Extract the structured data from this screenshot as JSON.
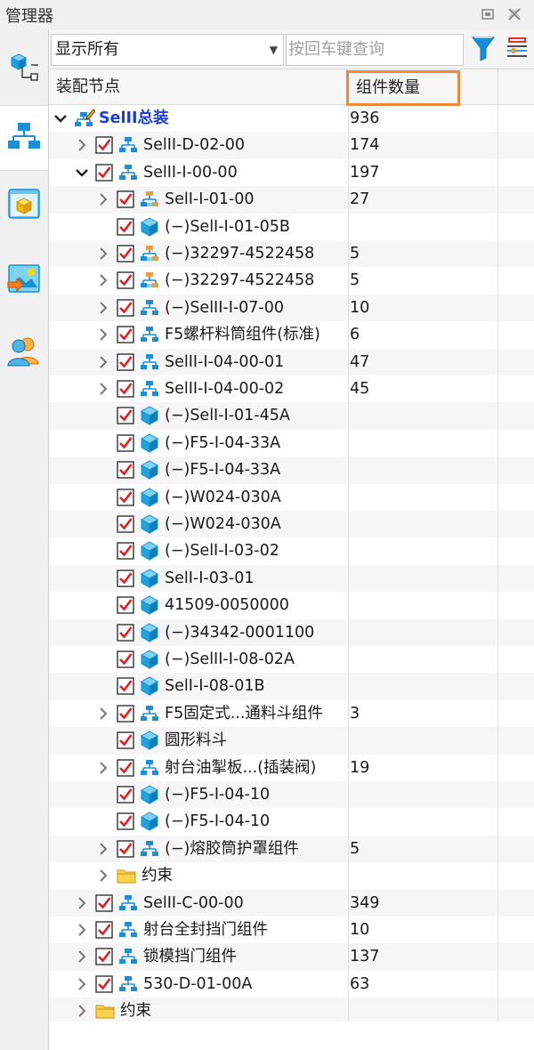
{
  "window": {
    "title": "管理器"
  },
  "toolbar": {
    "filter_value": "显示所有",
    "search_placeholder": "按回车键查询"
  },
  "columns": {
    "node": "装配节点",
    "count": "组件数量"
  },
  "left_tabs": [
    {
      "name": "tab-assembly-constraint",
      "icon": "part-tree-icon"
    },
    {
      "name": "tab-assembly-tree",
      "icon": "hierarchy-icon",
      "active": true
    },
    {
      "name": "tab-part-view",
      "icon": "cube-window-icon"
    },
    {
      "name": "tab-image-view",
      "icon": "picture-arrow-icon"
    },
    {
      "name": "tab-users",
      "icon": "users-icon"
    }
  ],
  "rows": [
    {
      "level": 0,
      "expander": "down",
      "check": false,
      "icon": "assembly-edit",
      "label": "SelII总装",
      "count": "936",
      "root": true
    },
    {
      "level": 1,
      "expander": "right",
      "check": true,
      "icon": "assembly",
      "label": "SelII-D-02-00",
      "count": "174"
    },
    {
      "level": 1,
      "expander": "down",
      "check": true,
      "icon": "assembly",
      "label": "SelII-I-00-00",
      "count": "197"
    },
    {
      "level": 2,
      "expander": "right",
      "check": true,
      "icon": "assembly-multi",
      "label": "SelI-I-01-00",
      "count": "27"
    },
    {
      "level": 2,
      "expander": "",
      "check": true,
      "icon": "part",
      "label": "(−)SelI-I-01-05B",
      "count": ""
    },
    {
      "level": 2,
      "expander": "right",
      "check": true,
      "icon": "assembly-multi",
      "label": "(−)32297-4522458",
      "count": "5"
    },
    {
      "level": 2,
      "expander": "right",
      "check": true,
      "icon": "assembly-multi",
      "label": "(−)32297-4522458",
      "count": "5"
    },
    {
      "level": 2,
      "expander": "right",
      "check": true,
      "icon": "assembly",
      "label": "(−)SelII-I-07-00",
      "count": "10"
    },
    {
      "level": 2,
      "expander": "right",
      "check": true,
      "icon": "assembly",
      "label": "F5螺杆料筒组件(标准)",
      "count": "6"
    },
    {
      "level": 2,
      "expander": "right",
      "check": true,
      "icon": "assembly",
      "label": "SelII-I-04-00-01",
      "count": "47"
    },
    {
      "level": 2,
      "expander": "right",
      "check": true,
      "icon": "assembly",
      "label": "SelII-I-04-00-02",
      "count": "45"
    },
    {
      "level": 2,
      "expander": "",
      "check": true,
      "icon": "part",
      "label": "(−)SelI-I-01-45A",
      "count": ""
    },
    {
      "level": 2,
      "expander": "",
      "check": true,
      "icon": "part",
      "label": "(−)F5-I-04-33A",
      "count": ""
    },
    {
      "level": 2,
      "expander": "",
      "check": true,
      "icon": "part",
      "label": "(−)F5-I-04-33A",
      "count": ""
    },
    {
      "level": 2,
      "expander": "",
      "check": true,
      "icon": "part",
      "label": "(−)W024-030A",
      "count": ""
    },
    {
      "level": 2,
      "expander": "",
      "check": true,
      "icon": "part",
      "label": "(−)W024-030A",
      "count": ""
    },
    {
      "level": 2,
      "expander": "",
      "check": true,
      "icon": "part",
      "label": "(−)SelI-I-03-02",
      "count": ""
    },
    {
      "level": 2,
      "expander": "",
      "check": true,
      "icon": "part",
      "label": "SelI-I-03-01",
      "count": ""
    },
    {
      "level": 2,
      "expander": "",
      "check": true,
      "icon": "part",
      "label": "41509-0050000",
      "count": ""
    },
    {
      "level": 2,
      "expander": "",
      "check": true,
      "icon": "part",
      "label": "(−)34342-0001100",
      "count": ""
    },
    {
      "level": 2,
      "expander": "",
      "check": true,
      "icon": "part",
      "label": "(−)SelII-I-08-02A",
      "count": ""
    },
    {
      "level": 2,
      "expander": "",
      "check": true,
      "icon": "part",
      "label": "SelI-I-08-01B",
      "count": ""
    },
    {
      "level": 2,
      "expander": "right",
      "check": true,
      "icon": "assembly",
      "label": "F5固定式...通料斗组件",
      "count": "3"
    },
    {
      "level": 2,
      "expander": "",
      "check": true,
      "icon": "part",
      "label": "圆形料斗",
      "count": ""
    },
    {
      "level": 2,
      "expander": "right",
      "check": true,
      "icon": "assembly",
      "label": "射台油掣板...(插装阀)",
      "count": "19"
    },
    {
      "level": 2,
      "expander": "",
      "check": true,
      "icon": "part",
      "label": "(−)F5-I-04-10",
      "count": ""
    },
    {
      "level": 2,
      "expander": "",
      "check": true,
      "icon": "part",
      "label": "(−)F5-I-04-10",
      "count": ""
    },
    {
      "level": 2,
      "expander": "right",
      "check": true,
      "icon": "assembly",
      "label": "(−)熔胶筒护罩组件",
      "count": "5"
    },
    {
      "level": 2,
      "expander": "right",
      "check": false,
      "icon": "folder",
      "label": "约束",
      "count": ""
    },
    {
      "level": 1,
      "expander": "right",
      "check": true,
      "icon": "assembly",
      "label": "SelII-C-00-00",
      "count": "349"
    },
    {
      "level": 1,
      "expander": "right",
      "check": true,
      "icon": "assembly",
      "label": "射台全封挡门组件",
      "count": "10"
    },
    {
      "level": 1,
      "expander": "right",
      "check": true,
      "icon": "assembly",
      "label": "锁模挡门组件",
      "count": "137"
    },
    {
      "level": 1,
      "expander": "right",
      "check": true,
      "icon": "assembly",
      "label": "530-D-01-00A",
      "count": "63"
    },
    {
      "level": 1,
      "expander": "right",
      "check": false,
      "icon": "folder",
      "label": "约束",
      "count": ""
    }
  ],
  "colors": {
    "accent_orange": "#f0883a",
    "root_blue": "#1a3fd6",
    "check_red": "#e02020",
    "part_cyan": "#1fa3dc",
    "funnel_blue": "#1a8fd8"
  }
}
